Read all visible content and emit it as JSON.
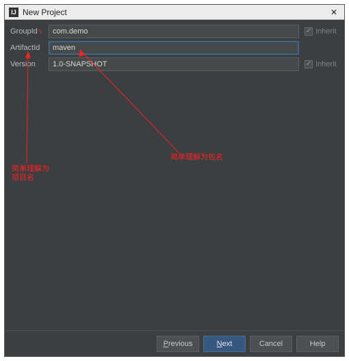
{
  "window": {
    "title": "New Project",
    "app_icon_text": "IJ"
  },
  "fields": {
    "groupId": {
      "label": "GroupId",
      "value": "com.demo",
      "inherit_label": "Inherit",
      "inherit_checked": true
    },
    "artifactId": {
      "label": "ArtifactId",
      "value": "maven"
    },
    "version": {
      "label": "Version",
      "value": "1.0-SNAPSHOT",
      "inherit_label": "Inherit",
      "inherit_checked": true
    }
  },
  "annotations": {
    "package_name_hint": "简单理解为包名",
    "project_name_hint_line1": "简单理解为",
    "project_name_hint_line2": "项目名"
  },
  "buttons": {
    "previous": "Previous",
    "next": "Next",
    "cancel": "Cancel",
    "help": "Help"
  },
  "colors": {
    "annotation": "#ff2020",
    "primary_btn": "#365880",
    "window_bg": "#3c3f41"
  }
}
